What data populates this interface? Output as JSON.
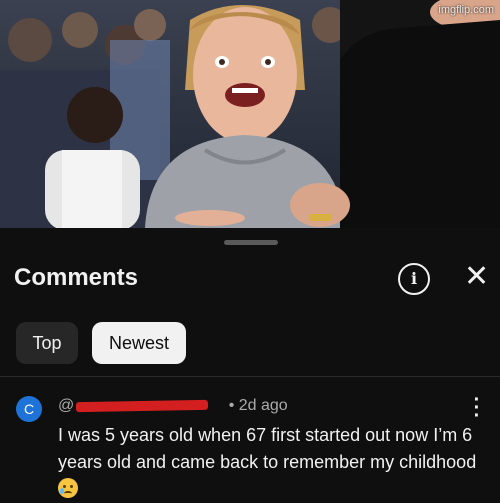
{
  "watermark": "imgflip.com",
  "comments_panel": {
    "title": "Comments",
    "info_icon": "info-icon",
    "close_icon": "close-icon",
    "sort_chips": [
      {
        "label": "Top",
        "selected": false
      },
      {
        "label": "Newest",
        "selected": true
      }
    ],
    "comment": {
      "avatar_letter": "C",
      "avatar_color": "#1e73d8",
      "handle": "@",
      "time": "• 2d ago",
      "text": "I was 5 years old when 67 first started out now I’m 6 years old and came back to remember my childhood",
      "emoji": "crying-face-icon"
    }
  },
  "colors": {
    "background": "#0f0f0f",
    "text": "#f1f1f1",
    "secondary_text": "#aaaaaa",
    "selected_chip": "#f1f1f1",
    "unselected_chip": "#272727",
    "redaction": "#d31f1f"
  }
}
